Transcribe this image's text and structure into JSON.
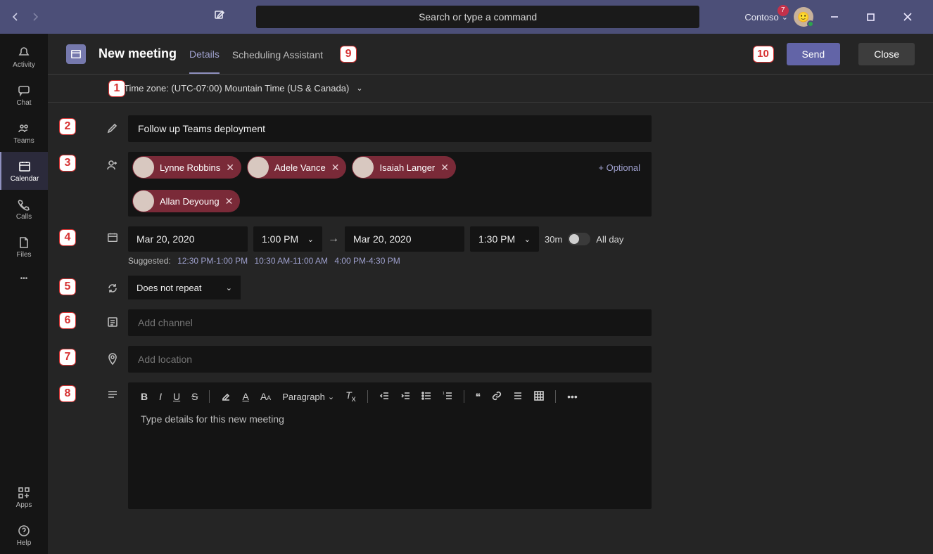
{
  "titlebar": {
    "search_placeholder": "Search or type a command",
    "org_name": "Contoso",
    "notification_count": "7"
  },
  "rail": {
    "items": [
      {
        "label": "Activity",
        "icon": "bell"
      },
      {
        "label": "Chat",
        "icon": "chat"
      },
      {
        "label": "Teams",
        "icon": "teams"
      },
      {
        "label": "Calendar",
        "icon": "calendar",
        "selected": true
      },
      {
        "label": "Calls",
        "icon": "phone"
      },
      {
        "label": "Files",
        "icon": "file"
      }
    ],
    "apps_label": "Apps",
    "help_label": "Help"
  },
  "header": {
    "page_title": "New meeting",
    "tab_details": "Details",
    "tab_scheduling": "Scheduling Assistant",
    "send": "Send",
    "close": "Close"
  },
  "timezone": {
    "label": "Time zone: (UTC-07:00) Mountain Time (US & Canada)"
  },
  "form": {
    "title_value": "Follow up Teams deployment",
    "attendees": [
      {
        "name": "Lynne Robbins"
      },
      {
        "name": "Adele Vance"
      },
      {
        "name": "Isaiah Langer"
      },
      {
        "name": "Allan Deyoung"
      }
    ],
    "optional_label": "+ Optional",
    "start_date": "Mar 20, 2020",
    "start_time": "1:00 PM",
    "end_date": "Mar 20, 2020",
    "end_time": "1:30 PM",
    "duration": "30m",
    "allday": "All day",
    "suggested_label": "Suggested:",
    "suggested": [
      "12:30 PM-1:00 PM",
      "10:30 AM-11:00 AM",
      "4:00 PM-4:30 PM"
    ],
    "repeat": "Does not repeat",
    "channel_placeholder": "Add channel",
    "location_placeholder": "Add location",
    "details_placeholder": "Type details for this new meeting",
    "paragraph_label": "Paragraph"
  },
  "annotations": {
    "n1": "1",
    "n2": "2",
    "n3": "3",
    "n4": "4",
    "n5": "5",
    "n6": "6",
    "n7": "7",
    "n8": "8",
    "n9": "9",
    "n10": "10"
  }
}
